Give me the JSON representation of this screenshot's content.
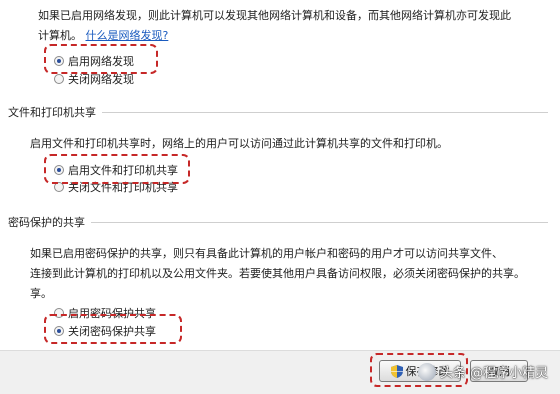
{
  "network_discovery": {
    "description": "如果已启用网络发现，则此计算机可以发现其他网络计算机和设备，而其他网络计算机亦可发现此",
    "description_line2": "计算机。",
    "help_link": "什么是网络发现?",
    "options": [
      "启用网络发现",
      "关闭网络发现"
    ],
    "selected": 0
  },
  "file_printer_sharing": {
    "title": "文件和打印机共享",
    "description": "启用文件和打印机共享时，网络上的用户可以访问通过此计算机共享的文件和打印机。",
    "options": [
      "启用文件和打印机共享",
      "关闭文件和打印机共享"
    ],
    "selected": 0
  },
  "password_sharing": {
    "title": "密码保护的共享",
    "description_lines": [
      "如果已启用密码保护的共享，则只有具备此计算机的用户帐户和密码的用户才可以访问共享文件、",
      "连接到此计算机的打印机以及公用文件夹。若要使其他用户具备访问权限，必须关闭密码保护的共享。",
      "享。"
    ],
    "options": [
      "启用密码保护共享",
      "关闭密码保护共享"
    ],
    "selected": 1
  },
  "footer": {
    "save_label": "保存修改",
    "cancel_label": "取消"
  },
  "watermark": {
    "text": "头条 @程序小精灵"
  },
  "colors": {
    "highlight": "#c62828",
    "link": "#1a5bbf",
    "footer_bg": "#f0f0f0"
  }
}
